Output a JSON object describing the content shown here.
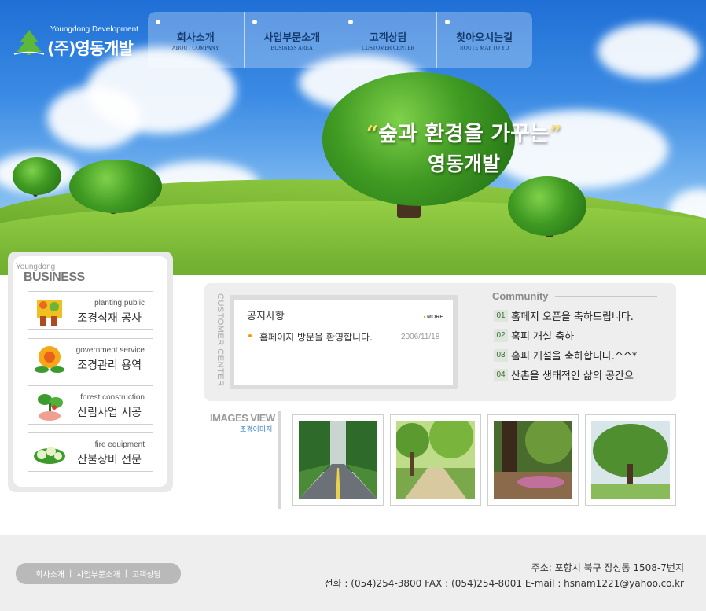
{
  "logo": {
    "english": "Youngdong Development",
    "korean": "(주)영동개발",
    "icon": "pine-tree-icon"
  },
  "nav": {
    "items": [
      {
        "ko": "회사소개",
        "en": "ABOUT COMPANY"
      },
      {
        "ko": "사업부문소개",
        "en": "BUSINESS AREA"
      },
      {
        "ko": "고객상담",
        "en": "CUSTOMER CENTER"
      },
      {
        "ko": "찾아오시는길",
        "en": "ROUTE MAP TO YD"
      }
    ]
  },
  "hero": {
    "slogan_line1": "숲과 환경을 가꾸는",
    "slogan_line2": "영동개발",
    "quote_open": "“",
    "quote_close": "”"
  },
  "business": {
    "subtitle": "Youngdong",
    "title": "BUSINESS",
    "items": [
      {
        "en": "planting public",
        "ko": "조경식재 공사",
        "icon": "planting-icon"
      },
      {
        "en": "government service",
        "ko": "조경관리 용역",
        "icon": "flower-icon"
      },
      {
        "en": "forest construction",
        "ko": "산림사업 시공",
        "icon": "plant-icon"
      },
      {
        "en": "fire equipment",
        "ko": "산불장비 전문",
        "icon": "fire-equipment-icon"
      }
    ]
  },
  "customer_center": {
    "vertical_label": "CUSTOMER CENTER",
    "notice": {
      "title": "공지사항",
      "more": "MORE",
      "items": [
        {
          "text": "홈페이지 방문을 환영합니다.",
          "date": "2006/11/18"
        }
      ]
    },
    "community": {
      "title": "Community",
      "items": [
        {
          "num": "01",
          "text": "홈페지 오픈을 축하드립니다."
        },
        {
          "num": "02",
          "text": "홈피 개설 축하"
        },
        {
          "num": "03",
          "text": "홈피 개설을 축하합니다.^^*"
        },
        {
          "num": "04",
          "text": "산촌을 생태적인 삶의 공간으"
        }
      ]
    }
  },
  "images_view": {
    "title": "IMAGES VIEW",
    "subtitle": "조경이미지",
    "thumbnails": [
      "tree-lined-road",
      "park-path",
      "forest-trail",
      "large-tree-park"
    ]
  },
  "footer": {
    "nav": [
      "회사소개",
      "사업부문소개",
      "고객상담"
    ],
    "separator": "|",
    "address": "주소: 포항시 북구 장성동 1508-7번지",
    "contact": "전화 : (054)254-3800 FAX : (054)254-8001 E-mail : hsnam1221@yahoo.co.kr"
  },
  "colors": {
    "accent_orange": "#f29a00",
    "nav_text": "#123a6e",
    "link_blue": "#3f86c8",
    "grass": "#74b232"
  }
}
